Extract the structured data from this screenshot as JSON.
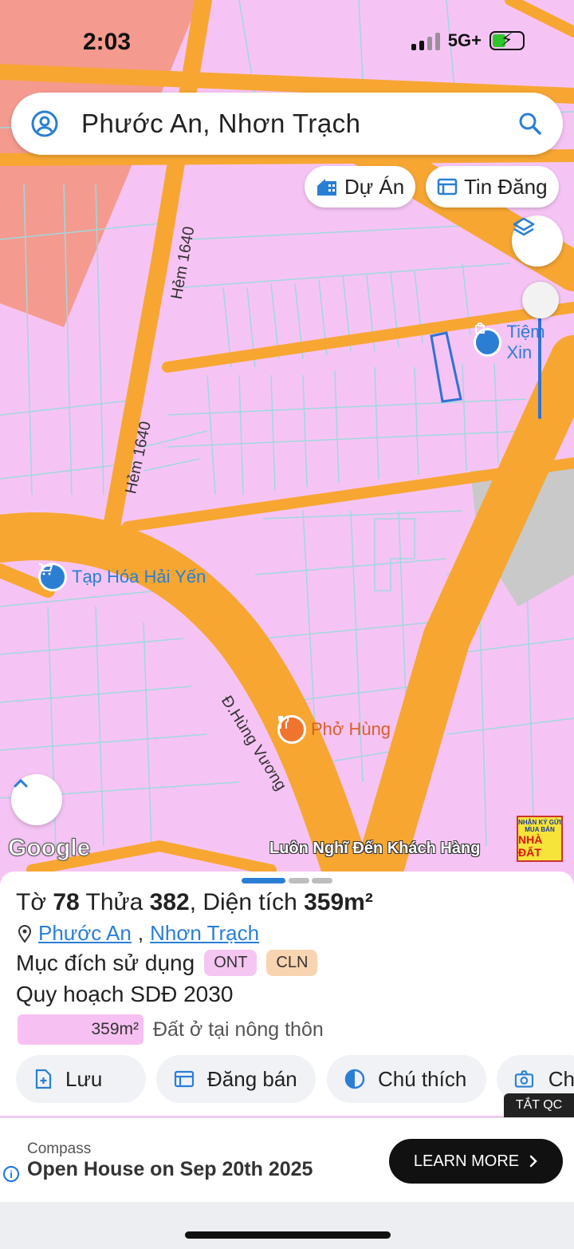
{
  "status": {
    "time": "2:03",
    "network": "5G+",
    "battery_level": 0.45
  },
  "search": {
    "text": "Phước An, Nhơn Trạch"
  },
  "chips": {
    "projects_label": "Dự Án",
    "listings_label": "Tin Đăng"
  },
  "map": {
    "road_labels": {
      "hem_top": "Hẻm 1640",
      "hem_bottom": "Hẻm 1640",
      "hung_vuong": "Đ.Hùng Vương"
    },
    "pois": {
      "tiem": "Tiệm Xin",
      "taphoa": "Tạp Hóa Hải Yến",
      "pho": "Phở Hùng"
    },
    "google_label": "Google",
    "watermark": "Luôn Nghĩ Đến Khách Hàng",
    "logo": {
      "line1": "NHẬN KÝ GỬI",
      "line2": "MUA BÁN",
      "line3": "NHÀ ĐẤT"
    },
    "colors": {
      "land": "#f6c4f4",
      "road": "#f7a632",
      "parcel_line": "#9fd8de",
      "commercial": "#f59a8e",
      "highlight": "#2f72d6"
    }
  },
  "sheet": {
    "title": {
      "to_label": "Tờ",
      "to_value": "78",
      "thua_label": "Thửa",
      "thua_value": "382",
      "area_label": ", Diện tích",
      "area_value": "359m²"
    },
    "location": {
      "ward": "Phước An",
      "district": "Nhơn Trạch"
    },
    "usage_label": "Mục đích sử dụng",
    "usage_tags": [
      {
        "code": "ONT",
        "color": "#f5c6f2"
      },
      {
        "code": "CLN",
        "color": "#f9d4b0"
      }
    ],
    "planning_label": "Quy hoạch SDĐ 2030",
    "legend": {
      "area": "359m²",
      "description": "Đất ở tại nông thôn"
    },
    "actions": {
      "save": "Lưu",
      "post": "Đăng bán",
      "note": "Chú thích",
      "capture": "Ch"
    },
    "ad_close": "TẮT QC"
  },
  "ad": {
    "brand": "Compass",
    "headline": "Open House on Sep 20th 2025",
    "cta": "LEARN MORE"
  }
}
